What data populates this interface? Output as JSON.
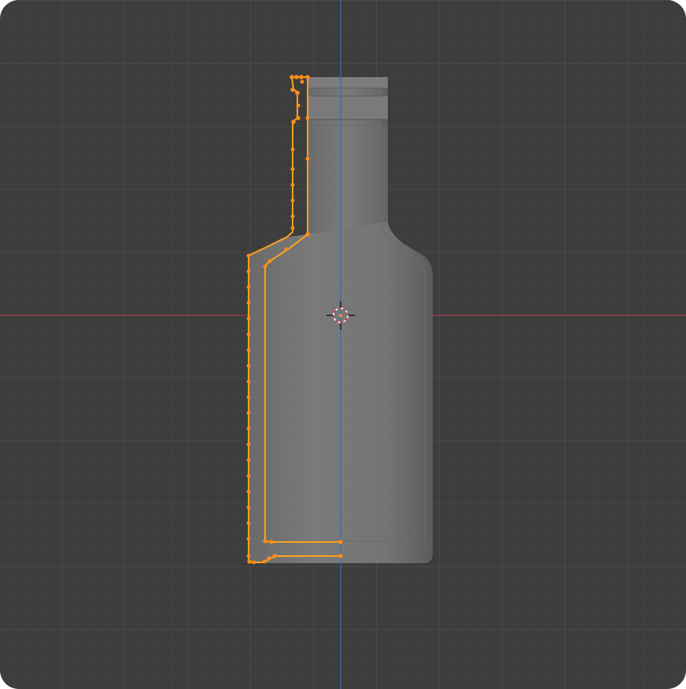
{
  "viewport": {
    "view": "front-orthographic",
    "mode": "edit-mode",
    "object": "bottle",
    "selection_color": "#ff8c1a",
    "grid_minor_color": "#484848",
    "grid_major_color": "#555555",
    "x_axis_color": "#b2394a",
    "z_axis_color": "#3a6ea5",
    "background_color": "#3d3d3d",
    "cursor_icon": "3d-cursor-icon"
  }
}
